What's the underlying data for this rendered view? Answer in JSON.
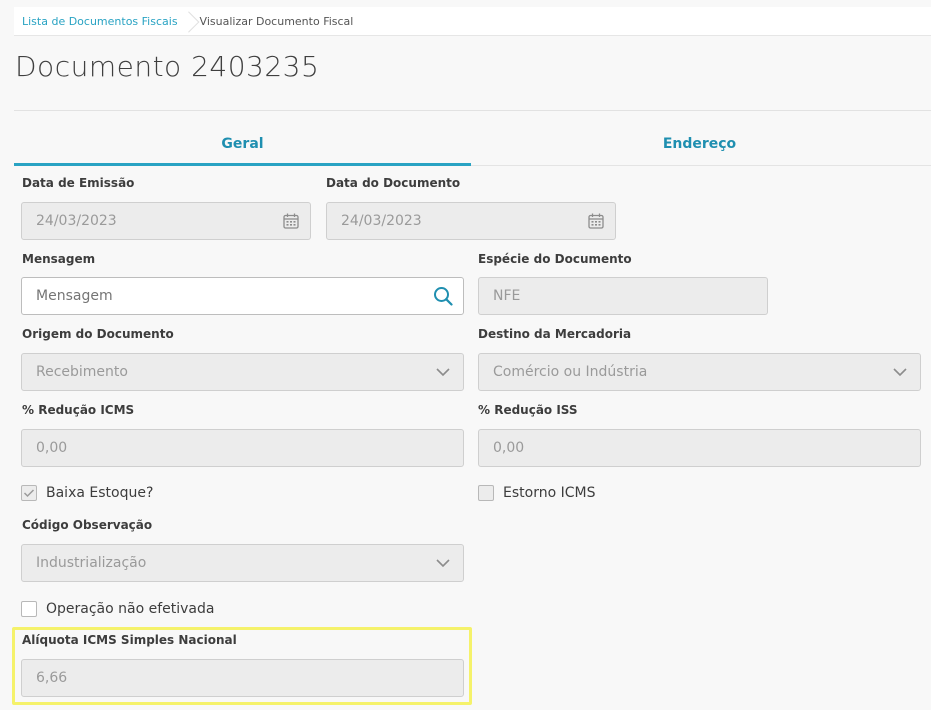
{
  "breadcrumb": {
    "link": "Lista de Documentos Fiscais",
    "current": "Visualizar Documento Fiscal"
  },
  "page_title": "Documento 2403235",
  "tabs": [
    {
      "label": "Geral",
      "active": true
    },
    {
      "label": "Endereço",
      "active": false
    }
  ],
  "form": {
    "data_emissao": {
      "label": "Data de Emissão",
      "value": "24/03/2023",
      "icon": "calendar-icon"
    },
    "data_documento": {
      "label": "Data do Documento",
      "value": "24/03/2023",
      "icon": "calendar-icon"
    },
    "mensagem": {
      "label": "Mensagem",
      "placeholder": "Mensagem",
      "icon": "search-icon"
    },
    "especie": {
      "label": "Espécie do Documento",
      "value": "NFE"
    },
    "origem": {
      "label": "Origem do Documento",
      "value": "Recebimento",
      "icon": "chevron-down-icon"
    },
    "destino": {
      "label": "Destino da Mercadoria",
      "value": "Comércio ou Indústria",
      "icon": "chevron-down-icon"
    },
    "reducao_icms": {
      "label": "% Redução ICMS",
      "value": "0,00"
    },
    "reducao_iss": {
      "label": "% Redução ISS",
      "value": "0,00"
    },
    "baixa_estoque": {
      "label": "Baixa Estoque?",
      "checked": true
    },
    "estorno_icms": {
      "label": "Estorno ICMS",
      "checked": false
    },
    "codigo_observacao": {
      "label": "Código Observação",
      "value": "Industrialização",
      "icon": "chevron-down-icon"
    },
    "operacao_nao_efetivada": {
      "label": "Operação não efetivada",
      "checked": false
    },
    "aliquota_icms_sn": {
      "label": "Alíquota ICMS Simples Nacional",
      "value": "6,66"
    }
  },
  "colors": {
    "accent": "#29a3c3",
    "highlight": "#f5f26a"
  }
}
